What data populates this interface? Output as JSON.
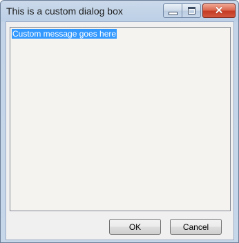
{
  "window": {
    "title": "This is a custom dialog box",
    "controls": {
      "minimize_icon": "minimize-icon",
      "maximize_icon": "maximize-icon",
      "close_icon": "close-icon",
      "close_glyph": "✕"
    }
  },
  "message_box": {
    "text": "Custom message goes here",
    "selected": true
  },
  "buttons": {
    "ok_label": "OK",
    "cancel_label": "Cancel"
  },
  "colors": {
    "selection": "#3399ff",
    "close_button": "#c9492f",
    "frame": "#c3d4e8"
  }
}
